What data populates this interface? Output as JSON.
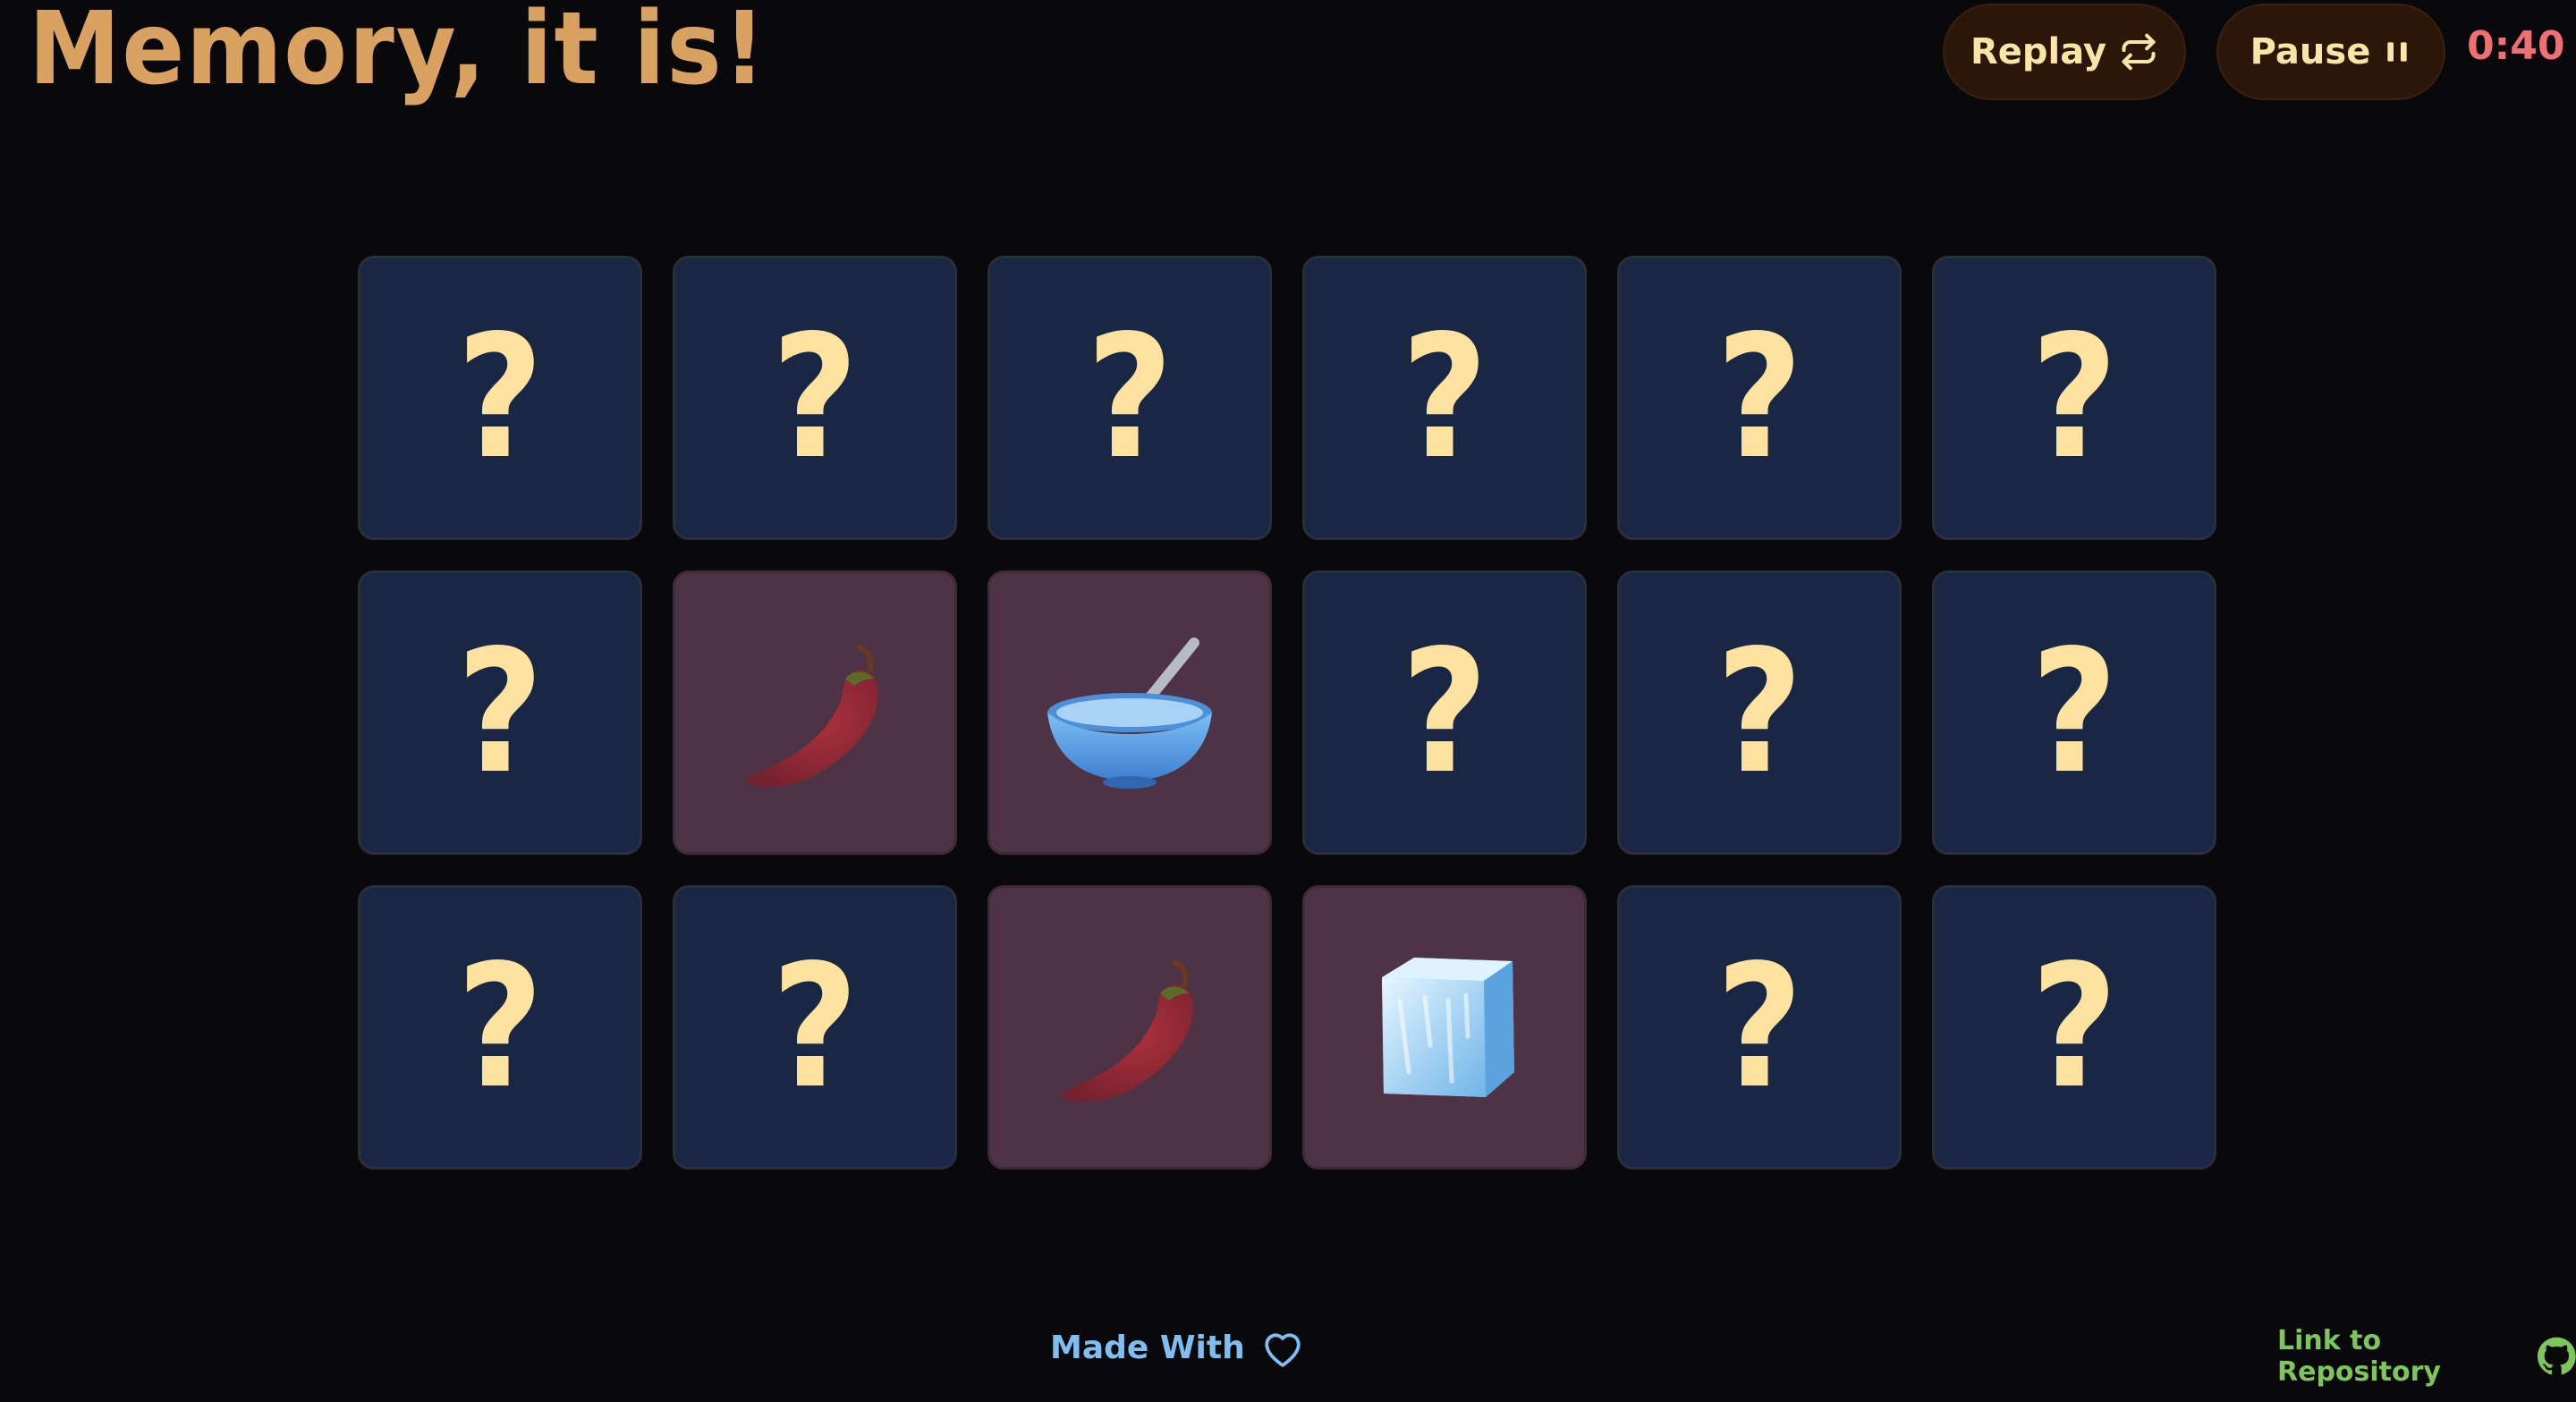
{
  "header": {
    "title": "Memory, it is!",
    "replay_label": "Replay",
    "pause_label": "Pause",
    "timer": "0:40"
  },
  "board": {
    "rows": 3,
    "columns": 6,
    "hidden_symbol": "?",
    "cards": [
      {
        "state": "hidden"
      },
      {
        "state": "hidden"
      },
      {
        "state": "hidden"
      },
      {
        "state": "hidden"
      },
      {
        "state": "hidden"
      },
      {
        "state": "hidden"
      },
      {
        "state": "hidden"
      },
      {
        "state": "revealed",
        "icon": "chili-pepper-icon"
      },
      {
        "state": "revealed",
        "icon": "bowl-with-spoon-icon"
      },
      {
        "state": "hidden"
      },
      {
        "state": "hidden"
      },
      {
        "state": "hidden"
      },
      {
        "state": "hidden"
      },
      {
        "state": "hidden"
      },
      {
        "state": "revealed",
        "icon": "chili-pepper-icon"
      },
      {
        "state": "revealed",
        "icon": "ice-cube-icon"
      },
      {
        "state": "hidden"
      },
      {
        "state": "hidden"
      }
    ]
  },
  "footer": {
    "made_with_label": "Made With",
    "repo_link_label": "Link to Repository"
  },
  "colors": {
    "background": "#09090b",
    "title": "#d9a261",
    "card_hidden": "#1a2744",
    "card_revealed": "#4d3345",
    "question_mark": "#fde39f",
    "timer": "#ef6f73",
    "made_with": "#7fbef3",
    "repo_link": "#7ec55e"
  }
}
